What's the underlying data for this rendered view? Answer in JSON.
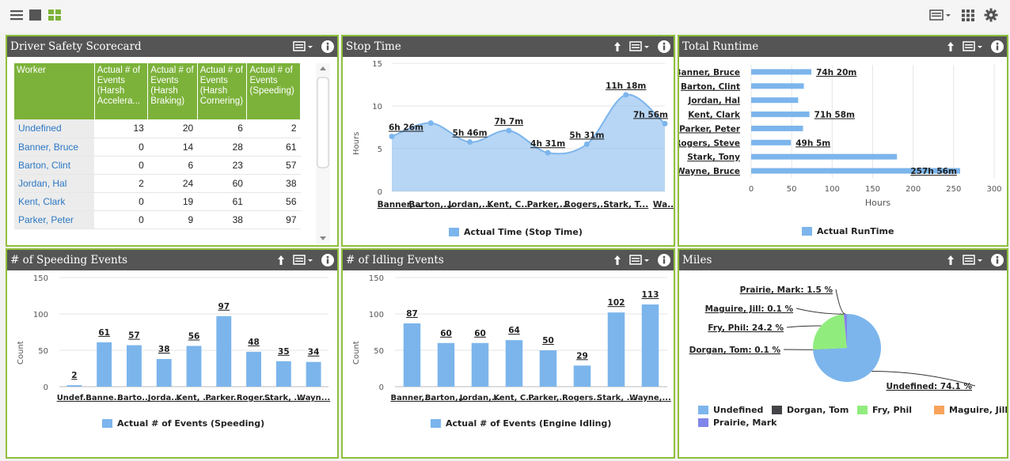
{
  "toolbar": {
    "left_icons": [
      "menu-icon",
      "square-icon",
      "grid-tiles-icon"
    ],
    "right_icons": [
      "layout-menu-icon",
      "apps-grid-icon",
      "gear-icon"
    ],
    "accent": "#8fbf3c"
  },
  "scorecard": {
    "title": "Driver Safety Scorecard",
    "headers": [
      "Worker",
      "Actual # of Events (Harsh Accelera...",
      "Actual # of Events (Harsh Braking)",
      "Actual # of Events (Harsh Cornering)",
      "Actual # of Events (Speeding)"
    ],
    "rows": [
      {
        "worker": "Undefined",
        "vals": [
          "13",
          "20",
          "6",
          "2"
        ]
      },
      {
        "worker": "Banner, Bruce",
        "vals": [
          "0",
          "14",
          "28",
          "61"
        ]
      },
      {
        "worker": "Barton, Clint",
        "vals": [
          "0",
          "6",
          "23",
          "57"
        ]
      },
      {
        "worker": "Jordan, Hal",
        "vals": [
          "2",
          "24",
          "60",
          "38"
        ]
      },
      {
        "worker": "Kent, Clark",
        "vals": [
          "0",
          "19",
          "61",
          "56"
        ]
      },
      {
        "worker": "Parker, Peter",
        "vals": [
          "0",
          "9",
          "38",
          "97"
        ]
      }
    ]
  },
  "stop_time": {
    "title": "Stop Time",
    "ylabel": "Hours",
    "legend": "Actual Time (Stop Time)",
    "chart_data": {
      "type": "area",
      "categories": [
        "Banner,...",
        "Barton,...",
        "Jordan,...",
        "Kent, C...",
        "Parker,...",
        "Rogers,...",
        "Stark, T...",
        "Wa..."
      ],
      "values": [
        6.43,
        8.0,
        5.77,
        7.12,
        4.52,
        5.52,
        11.3,
        7.93
      ],
      "labels": [
        "6h 26m",
        "",
        "5h 46m",
        "7h 7m",
        "4h 31m",
        "5h 31m",
        "11h 18m",
        "7h 56m"
      ],
      "yticks": [
        "15",
        "10",
        "5",
        "0"
      ],
      "ylim": [
        0,
        15
      ],
      "color": "#7cb5ec"
    }
  },
  "runtime": {
    "title": "Total Runtime",
    "xlabel": "Hours",
    "legend": "Actual RunTime",
    "chart_data": {
      "type": "bar",
      "orientation": "horizontal",
      "categories": [
        "Banner, Bruce",
        "Barton, Clint",
        "Jordan, Hal",
        "Kent, Clark",
        "Parker, Peter",
        "Rogers, Steve",
        "Stark, Tony",
        "Wayne, Bruce"
      ],
      "values": [
        74.33,
        65,
        58,
        71.97,
        64,
        49.08,
        180,
        257.93
      ],
      "labels": [
        "74h 20m",
        "",
        "",
        "71h 58m",
        "",
        "49h 5m",
        "",
        "257h 56m"
      ],
      "xticks": [
        "0",
        "50",
        "100",
        "150",
        "200",
        "250",
        "300"
      ],
      "xlim": [
        0,
        300
      ],
      "color": "#7cb5ec"
    }
  },
  "speeding": {
    "title": "# of Speeding Events",
    "ylabel": "Count",
    "legend": "Actual # of Events (Speeding)",
    "chart_data": {
      "type": "bar",
      "categories": [
        "Undef...",
        "Banne...",
        "Barto...",
        "Jorda...",
        "Kent, ...",
        "Parker...",
        "Roger...",
        "Stark, ...",
        "Wayn..."
      ],
      "values": [
        2,
        61,
        57,
        38,
        56,
        97,
        48,
        35,
        34
      ],
      "yticks": [
        "150",
        "100",
        "50",
        "0"
      ],
      "ylim": [
        0,
        150
      ],
      "color": "#7cb5ec"
    }
  },
  "idling": {
    "title": "# of Idling Events",
    "ylabel": "Count",
    "legend": "Actual # of Events (Engine Idling)",
    "chart_data": {
      "type": "bar",
      "categories": [
        "Banner,...",
        "Barton,...",
        "Jordan,...",
        "Kent, C...",
        "Parker,...",
        "Rogers...",
        "Stark, ...",
        "Wayne,..."
      ],
      "values": [
        87,
        60,
        60,
        64,
        50,
        29,
        102,
        113
      ],
      "yticks": [
        "150",
        "100",
        "50",
        "0"
      ],
      "ylim": [
        0,
        150
      ],
      "color": "#7cb5ec"
    }
  },
  "miles": {
    "title": "Miles",
    "chart_data": {
      "type": "pie",
      "slices": [
        {
          "name": "Undefined",
          "value": 74.1,
          "label": "Undefined: 74.1 %",
          "color": "#7cb5ec"
        },
        {
          "name": "Dorgan, Tom",
          "value": 0.1,
          "label": "Dorgan, Tom: 0.1 %",
          "color": "#434348"
        },
        {
          "name": "Fry, Phil",
          "value": 24.2,
          "label": "Fry, Phil: 24.2 %",
          "color": "#90ed7d"
        },
        {
          "name": "Maguire, Jill",
          "value": 0.1,
          "label": "Maguire, Jill: 0.1 %",
          "color": "#f7a35c"
        },
        {
          "name": "Prairie, Mark",
          "value": 1.5,
          "label": "Prairie, Mark: 1.5 %",
          "color": "#8085e9"
        }
      ]
    }
  }
}
